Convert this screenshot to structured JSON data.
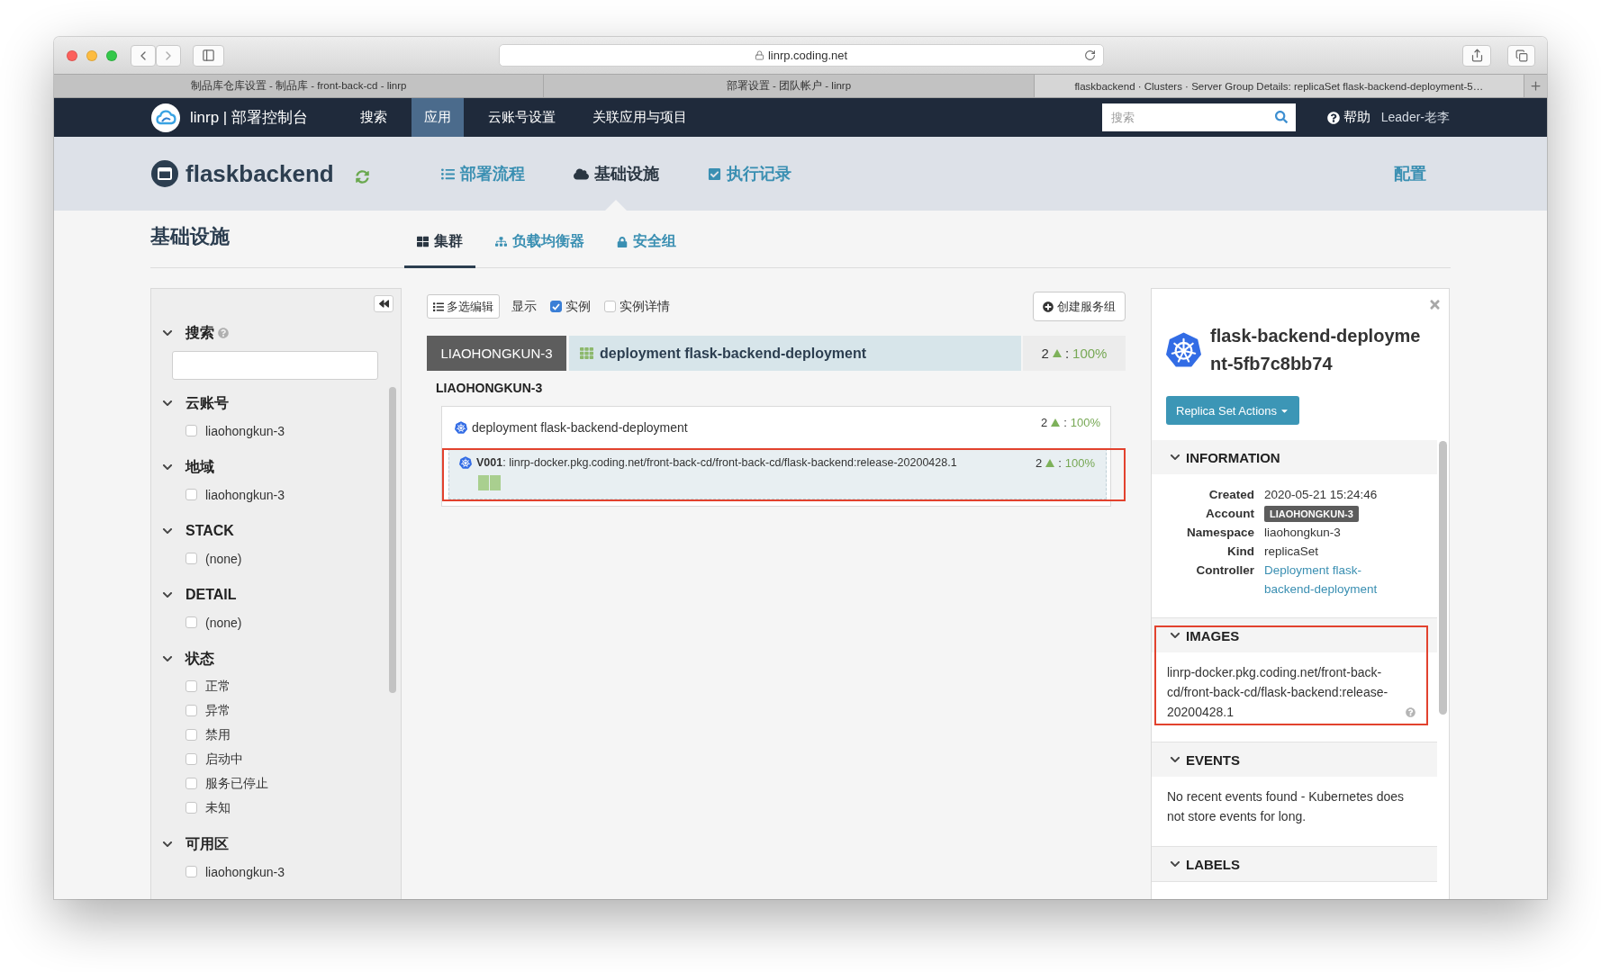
{
  "browser": {
    "url": "linrp.coding.net",
    "tabs": [
      {
        "title": "制品库仓库设置 - 制品库 - front-back-cd - linrp",
        "selected": false
      },
      {
        "title": "部署设置 - 团队帐户 - linrp",
        "selected": false
      },
      {
        "title": "flaskbackend · Clusters · Server Group Details: replicaSet flask-backend-deployment-5…",
        "selected": true
      }
    ]
  },
  "navbar": {
    "brand": "linrp | 部署控制台",
    "menu": [
      {
        "label": "搜索",
        "selected": false
      },
      {
        "label": "应用",
        "selected": true
      },
      {
        "label": "云账号设置",
        "selected": false
      },
      {
        "label": "关联应用与项目",
        "selected": false
      }
    ],
    "search": {
      "placeholder": "搜索"
    },
    "help": "帮助",
    "user": "Leader-老李"
  },
  "app_header": {
    "name": "flaskbackend",
    "tabs": [
      {
        "kind": "pipeline",
        "label": "部署流程",
        "selected": false
      },
      {
        "kind": "infrastructure",
        "label": "基础设施",
        "selected": true
      },
      {
        "kind": "executions",
        "label": "执行记录",
        "selected": false
      }
    ],
    "config": "配置"
  },
  "page": {
    "title": "基础设施",
    "tabs": [
      {
        "kind": "clusters",
        "label": "集群",
        "selected": true
      },
      {
        "kind": "load_balancers",
        "label": "负载均衡器",
        "selected": false
      },
      {
        "kind": "security_groups",
        "label": "安全组",
        "selected": false
      }
    ]
  },
  "filters": {
    "search": {
      "label": "搜索",
      "expanded": true
    },
    "sections": [
      {
        "title": "云账号",
        "expanded": true,
        "options": [
          {
            "label": "liaohongkun-3",
            "checked": false
          }
        ]
      },
      {
        "title": "地域",
        "expanded": true,
        "options": [
          {
            "label": "liaohongkun-3",
            "checked": false
          }
        ]
      },
      {
        "title": "STACK",
        "expanded": true,
        "options": [
          {
            "label": "(none)",
            "checked": false
          }
        ]
      },
      {
        "title": "DETAIL",
        "expanded": true,
        "options": [
          {
            "label": "(none)",
            "checked": false
          }
        ]
      },
      {
        "title": "状态",
        "expanded": true,
        "options": [
          {
            "label": "正常",
            "checked": false
          },
          {
            "label": "异常",
            "checked": false
          },
          {
            "label": "禁用",
            "checked": false
          },
          {
            "label": "启动中",
            "checked": false
          },
          {
            "label": "服务已停止",
            "checked": false
          },
          {
            "label": "未知",
            "checked": false
          }
        ]
      },
      {
        "title": "可用区",
        "expanded": true,
        "options": [
          {
            "label": "liaohongkun-3",
            "checked": false
          }
        ]
      }
    ]
  },
  "toolbar": {
    "multi_edit": "多选编辑",
    "show_label": "显示",
    "options": [
      {
        "label": "实例",
        "checked": true
      },
      {
        "label": "实例详情",
        "checked": false
      }
    ],
    "create": "创建服务组"
  },
  "cluster": {
    "account": "LIAOHONGKUN-3",
    "title": "deployment flask-backend-deployment",
    "count": "2",
    "separator": ":",
    "percent": "100%",
    "region": "LIAOHONGKUN-3",
    "rows": [
      {
        "kind": "deployment",
        "name": "deployment flask-backend-deployment",
        "count": "2",
        "separator": ":",
        "percent": "100%",
        "selected": false,
        "highlighted": false
      },
      {
        "kind": "replicaset",
        "name": "**V001**: linrp-docker.pkg.coding.net/front-back-cd/front-back-cd/flask-backend:release-20200428.1",
        "count": "2",
        "separator": ":",
        "percent": "100%",
        "selected": true,
        "highlighted": true,
        "instances": [
          {
            "healthy": true
          },
          {
            "healthy": true
          }
        ]
      }
    ]
  },
  "details": {
    "title": "flask-backend-deployment-5fb7c8bb74",
    "actions": "Replica Set Actions",
    "sections": [
      {
        "kind": "fields",
        "title": "INFORMATION",
        "expanded": true,
        "highlighted": false,
        "fields": [
          {
            "kind": "text",
            "label": "Created",
            "value": "2020-05-21 15:24:46"
          },
          {
            "kind": "badge",
            "label": "Account",
            "value": "LIAOHONGKUN-3"
          },
          {
            "kind": "text",
            "label": "Namespace",
            "value": "liaohongkun-3"
          },
          {
            "kind": "text",
            "label": "Kind",
            "value": "replicaSet"
          },
          {
            "kind": "link",
            "label": "Controller",
            "value": "Deployment flask-backend-deployment"
          }
        ]
      },
      {
        "kind": "image",
        "title": "IMAGES",
        "expanded": true,
        "highlighted": true,
        "text": "linrp-docker.pkg.coding.net/front-back-cd/front-back-cd/flask-backend:release-20200428.1"
      },
      {
        "kind": "text",
        "title": "EVENTS",
        "expanded": true,
        "highlighted": false,
        "text": "No recent events found - Kubernetes does not store events for long."
      },
      {
        "kind": "empty",
        "title": "LABELS",
        "expanded": true,
        "highlighted": false
      }
    ]
  }
}
